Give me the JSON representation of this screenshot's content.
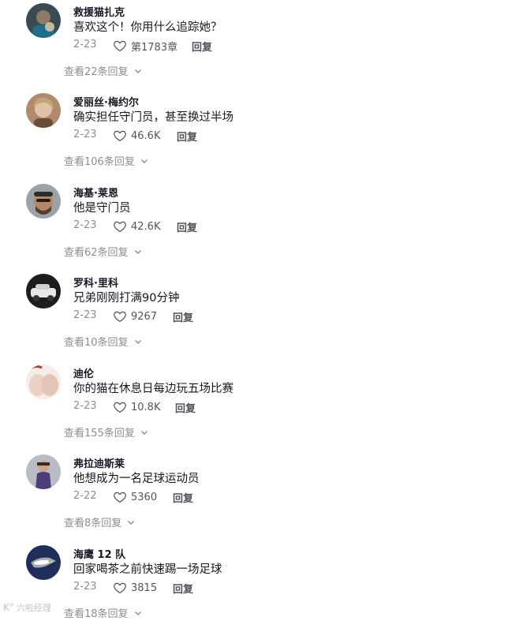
{
  "comments": [
    {
      "username": "救援猫扎克",
      "text": "喜欢这个！你用什么追踪她？",
      "date": "2-23",
      "likes": "第1783章",
      "reply_label": "回复",
      "view_replies": "查看22条回复",
      "avatar_color": "#3a4a52"
    },
    {
      "username": "爱丽丝·梅约尔",
      "text": "确实担任守门员，甚至换过半场",
      "date": "2-23",
      "likes": "46.6K",
      "reply_label": "回复",
      "view_replies": "查看106条回复",
      "avatar_color": "#c9a17d"
    },
    {
      "username": "海基·莱恩",
      "text": "他是守门员",
      "date": "2-23",
      "likes": "42.6K",
      "reply_label": "回复",
      "view_replies": "查看62条回复",
      "avatar_color": "#6b5a4a"
    },
    {
      "username": "罗科·里科",
      "text": "兄弟刚刚打满90分钟",
      "date": "2-23",
      "likes": "9267",
      "reply_label": "回复",
      "view_replies": "查看10条回复",
      "avatar_color": "#2a2a2a"
    },
    {
      "username": "迪伦",
      "text": "你的猫在休息日每边玩五场比赛",
      "date": "2-23",
      "likes": "10.8K",
      "reply_label": "回复",
      "view_replies": "查看155条回复",
      "avatar_color": "#e8d6cc"
    },
    {
      "username": "弗拉迪斯莱",
      "text": "他想成为一名足球运动员",
      "date": "2-22",
      "likes": "5360",
      "reply_label": "回复",
      "view_replies": "查看8条回复",
      "avatar_color": "#8a8a95"
    },
    {
      "username": "海鹰 12 队",
      "text": "回家喝茶之前快速踢一场足球",
      "date": "2-23",
      "likes": "3815",
      "reply_label": "回复",
      "view_replies": "查看18条回复",
      "avatar_color": "#1e2f5a"
    }
  ],
  "watermark": "六啦经理"
}
